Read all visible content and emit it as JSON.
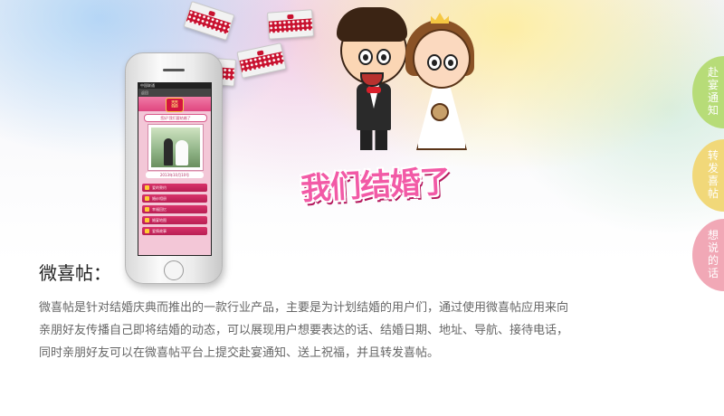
{
  "side_tabs": [
    {
      "label": "赴宴通知",
      "color": "#b7dc78"
    },
    {
      "label": "转发喜帖",
      "color": "#f1d879"
    },
    {
      "label": "想说的话",
      "color": "#f1a8b6"
    }
  ],
  "banner": {
    "title": "我们结婚了"
  },
  "phone": {
    "status_text": "中国联通",
    "nav_text": "返回",
    "header_symbol": "囍",
    "invite_text": "您好!我们要结婚了",
    "date_text": "2013年10月10号",
    "menu_items": [
      "爱的誓约",
      "婚纱相册",
      "幸福回忆",
      "婚宴地图",
      "爱情故事"
    ]
  },
  "content": {
    "title": "微喜帖：",
    "description_lines": [
      "微喜帖是针对结婚庆典而推出的一款行业产品，主要是为计划结婚的用户们，通过使用微喜帖应用来向",
      "亲朋好友传播自己即将结婚的动态，可以展现用户想要表达的话、结婚日期、地址、导航、接待电话，",
      "同时亲朋好友可以在微喜帖平台上提交赴宴通知、送上祝福，并且转发喜帖。"
    ]
  },
  "colors": {
    "accent_pink": "#e0467f",
    "title_pink": "#f25aa6",
    "text_gray": "#666666"
  }
}
